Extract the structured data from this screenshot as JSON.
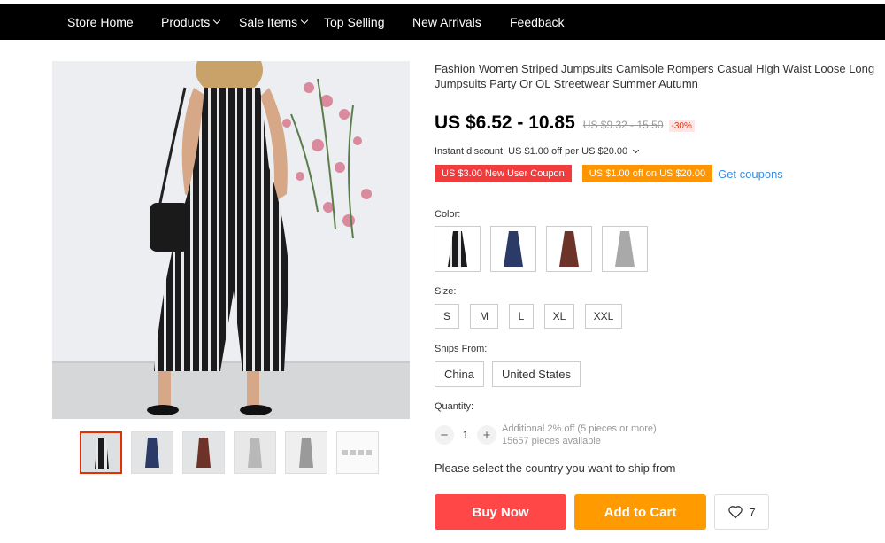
{
  "nav": {
    "items": [
      {
        "label": "Store Home",
        "dropdown": false
      },
      {
        "label": "Products",
        "dropdown": true
      },
      {
        "label": "Sale Items",
        "dropdown": true
      },
      {
        "label": "Top Selling",
        "dropdown": false
      },
      {
        "label": "New Arrivals",
        "dropdown": false
      },
      {
        "label": "Feedback",
        "dropdown": false
      }
    ]
  },
  "product": {
    "title": "Fashion Women Striped Jumpsuits Camisole Rompers Casual High Waist Loose Long Jumpsuits Party Or OL Streetwear Summer Autumn",
    "price": "US $6.52 - 10.85",
    "original_price": "US $9.32 - 15.50",
    "discount": "-30%",
    "instant_discount": "Instant discount: US $1.00 off per US $20.00",
    "coupon_new_user": "US $3.00 New User Coupon",
    "coupon_off": "US $1.00 off on US $20.00",
    "get_coupons": "Get coupons",
    "color_label": "Color:",
    "colors": [
      "black",
      "navy",
      "brown",
      "light-gray"
    ],
    "size_label": "Size:",
    "sizes": [
      "S",
      "M",
      "L",
      "XL",
      "XXL"
    ],
    "ships_from_label": "Ships From:",
    "ships_from": [
      "China",
      "United States"
    ],
    "quantity_label": "Quantity:",
    "quantity": "1",
    "quantity_info_1": "Additional 2% off (5 pieces or more)",
    "quantity_info_2": "15657 pieces available",
    "select_country": "Please select the country you want to ship from",
    "buy_now": "Buy Now",
    "add_to_cart": "Add to Cart",
    "wish_count": "7"
  },
  "colors": {
    "topbar": "#000000",
    "buy_now": "#ff4747",
    "add_to_cart": "#ff9a00",
    "coupon_red": "#f03c3c",
    "coupon_orange": "#ff9500",
    "link": "#3a8dde",
    "discount": "#e62e04"
  },
  "thumbnails": [
    "black",
    "navy",
    "brown",
    "gray",
    "light-gray",
    "size-chart"
  ]
}
